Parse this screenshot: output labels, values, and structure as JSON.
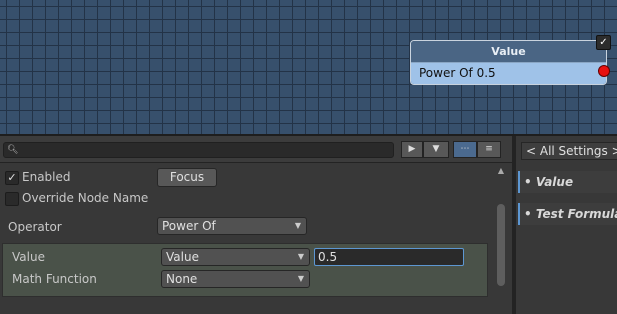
{
  "graph": {
    "node": {
      "title": "Value",
      "row_label": "Power Of 0.5",
      "enabled_check": "✓"
    }
  },
  "inspector": {
    "search": {
      "placeholder": "",
      "icon": "search-icon"
    },
    "toolbar": {
      "play_icon": "▶",
      "dropdown_icon": "▼"
    },
    "enabled": {
      "label": "Enabled",
      "checked": true,
      "check_glyph": "✓"
    },
    "focus_button": "Focus",
    "override_node_name": {
      "label": "Override Node Name",
      "checked": false
    },
    "operator": {
      "label": "Operator",
      "value": "Power Of"
    },
    "value": {
      "label": "Value",
      "dropdown": "Value",
      "input": "0.5"
    },
    "math_function": {
      "label": "Math Function",
      "value": "None"
    }
  },
  "settings_panel": {
    "header": "< All Settings >",
    "items": [
      "• Value",
      "• Test Formula"
    ]
  },
  "colors": {
    "graph_bg": "#37506c",
    "node_row": "#9fc2e8",
    "port": "#e81010",
    "accent": "#5d97d2"
  }
}
